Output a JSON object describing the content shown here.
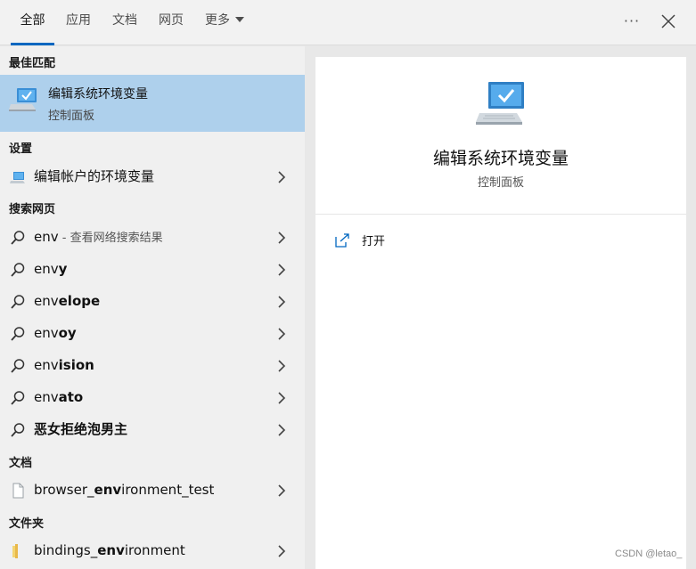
{
  "tabs": [
    {
      "label": "全部",
      "active": true
    },
    {
      "label": "应用"
    },
    {
      "label": "文档"
    },
    {
      "label": "网页"
    },
    {
      "label": "更多"
    }
  ],
  "window_controls": {
    "more_options": "···"
  },
  "sections": {
    "best_match": "最佳匹配",
    "settings": "设置",
    "web": "搜索网页",
    "documents": "文档",
    "folders": "文件夹"
  },
  "best_match": {
    "title": "编辑系统环境变量",
    "subtitle": "控制面板"
  },
  "settings_item": {
    "label": "编辑帐户的环境变量"
  },
  "web_results": [
    {
      "plain": "env",
      "bold": "",
      "note": " - 查看网络搜索结果"
    },
    {
      "plain": "env",
      "bold": "y"
    },
    {
      "plain": "env",
      "bold": "elope"
    },
    {
      "plain": "env",
      "bold": "oy"
    },
    {
      "plain": "env",
      "bold": "ision"
    },
    {
      "plain": "env",
      "bold": "ato"
    },
    {
      "plain": "",
      "bold": "恶女拒绝泡男主"
    }
  ],
  "document_item": {
    "pre": "browser_",
    "bold": "env",
    "post": "ironment_test"
  },
  "folder_item": {
    "pre": "bindings_",
    "bold": "env",
    "post": "ironment"
  },
  "detail": {
    "title": "编辑系统环境变量",
    "subtitle": "控制面板",
    "open_label": "打开"
  },
  "watermark": "CSDN @letao_",
  "colors": {
    "accent": "#0067c0",
    "selection": "#aed0ec"
  }
}
